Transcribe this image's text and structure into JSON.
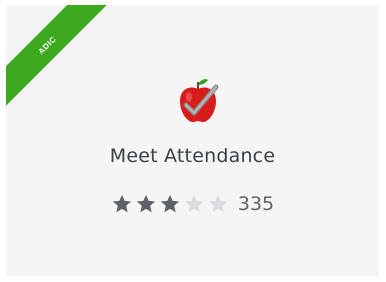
{
  "card": {
    "badge_label": "ADIC",
    "title": "Meet Attendance",
    "icon": "apple-checkmark-icon",
    "rating": {
      "filled_stars": 3,
      "total_stars": 5,
      "count": "335"
    }
  },
  "colors": {
    "card_background": "#f5f5f5",
    "ribbon": "#3ba81e",
    "star_filled": "#5f6368",
    "star_empty": "#dadce0",
    "title_text": "#3c4043"
  }
}
